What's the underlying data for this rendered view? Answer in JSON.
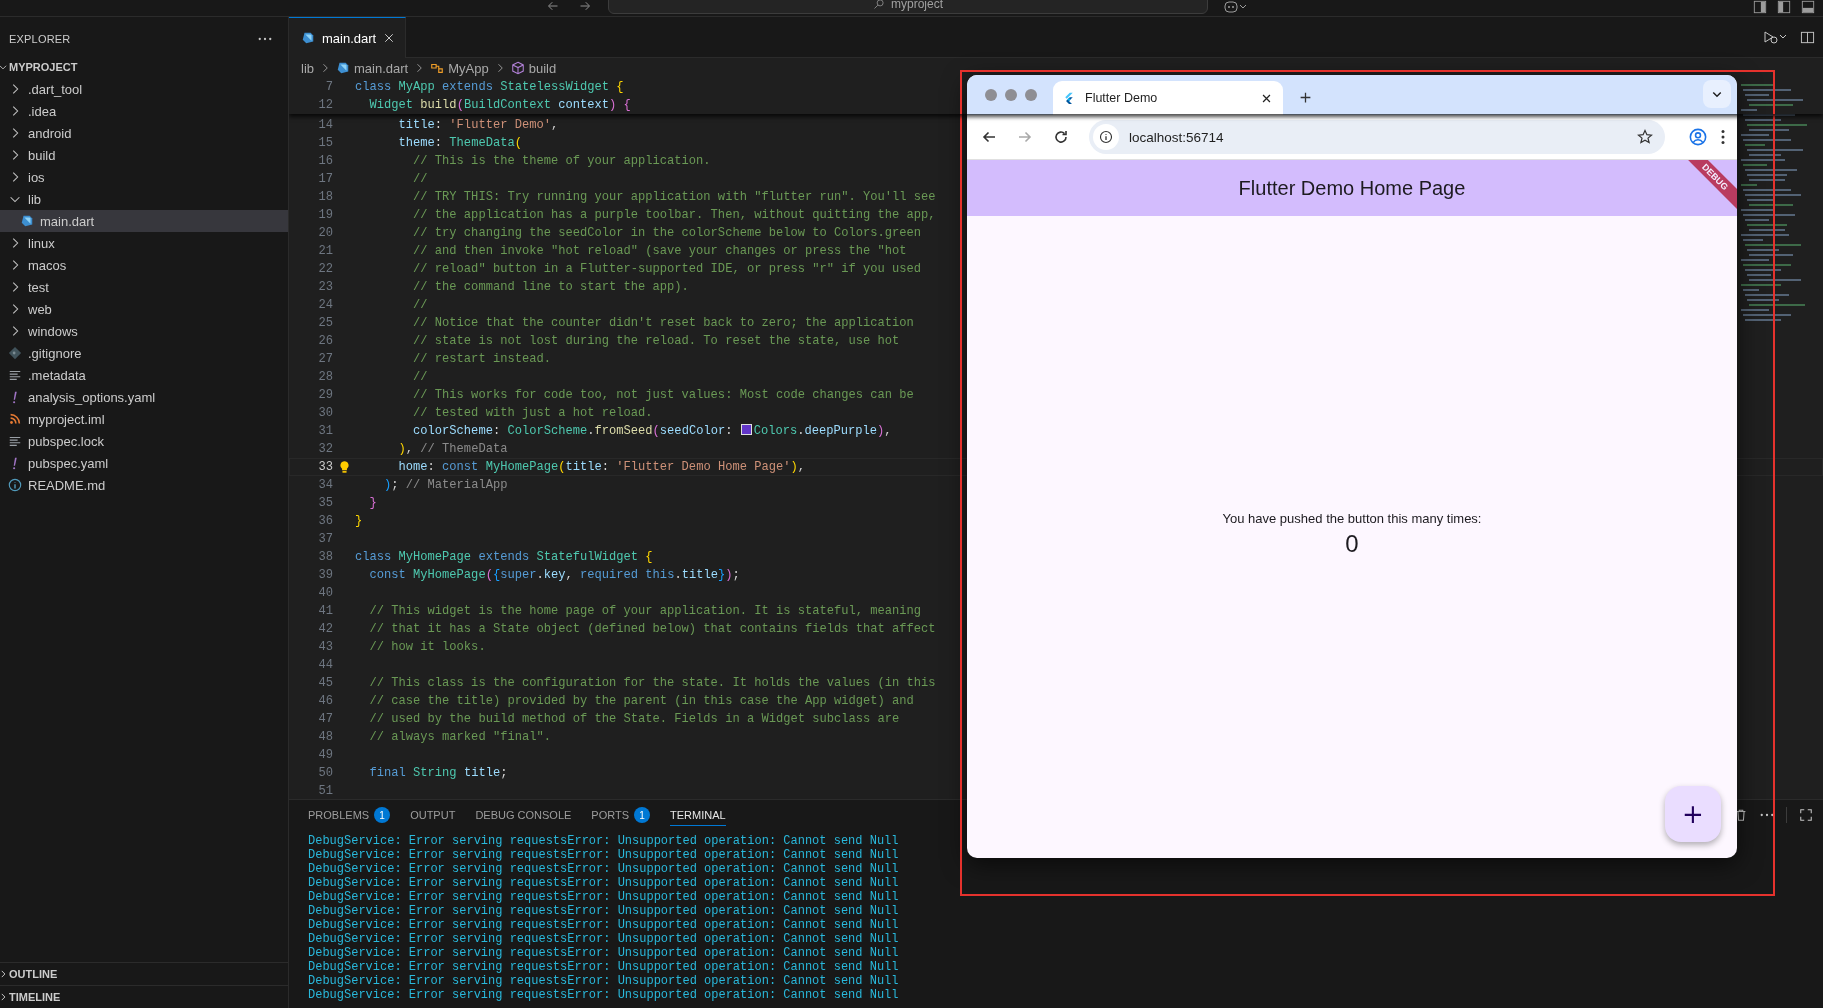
{
  "title_bar": {
    "search": "myproject"
  },
  "explorer": {
    "title": "EXPLORER",
    "project": {
      "label": "MYPROJECT",
      "expanded": true
    },
    "items": [
      {
        "label": ".dart_tool",
        "kind": "folder",
        "expanded": false,
        "selected": false
      },
      {
        "label": ".idea",
        "kind": "folder",
        "expanded": false,
        "selected": false
      },
      {
        "label": "android",
        "kind": "folder",
        "expanded": false,
        "selected": false
      },
      {
        "label": "build",
        "kind": "folder",
        "expanded": false,
        "selected": false
      },
      {
        "label": "ios",
        "kind": "folder",
        "expanded": false,
        "selected": false
      },
      {
        "label": "lib",
        "kind": "folder",
        "expanded": true,
        "selected": false,
        "children": [
          {
            "label": "main.dart",
            "kind": "dart",
            "selected": true
          }
        ]
      },
      {
        "label": "linux",
        "kind": "folder",
        "expanded": false,
        "selected": false
      },
      {
        "label": "macos",
        "kind": "folder",
        "expanded": false,
        "selected": false
      },
      {
        "label": "test",
        "kind": "folder",
        "expanded": false,
        "selected": false
      },
      {
        "label": "web",
        "kind": "folder",
        "expanded": false,
        "selected": false
      },
      {
        "label": "windows",
        "kind": "folder",
        "expanded": false,
        "selected": false
      },
      {
        "label": ".gitignore",
        "kind": "git",
        "selected": false
      },
      {
        "label": ".metadata",
        "kind": "lines",
        "selected": false
      },
      {
        "label": "analysis_options.yaml",
        "kind": "yaml",
        "selected": false
      },
      {
        "label": "myproject.iml",
        "kind": "rss",
        "selected": false
      },
      {
        "label": "pubspec.lock",
        "kind": "lines",
        "selected": false
      },
      {
        "label": "pubspec.yaml",
        "kind": "yaml",
        "selected": false
      },
      {
        "label": "README.md",
        "kind": "info",
        "selected": false
      }
    ],
    "sections": [
      {
        "label": "OUTLINE",
        "expanded": false
      },
      {
        "label": "TIMELINE",
        "expanded": false
      }
    ]
  },
  "editor": {
    "tabs": [
      {
        "label": "main.dart",
        "selected": true
      }
    ],
    "breadcrumbs": [
      {
        "label": "lib",
        "kind": "folder"
      },
      {
        "label": "main.dart",
        "kind": "dart"
      },
      {
        "label": "MyApp",
        "kind": "class"
      },
      {
        "label": "build",
        "kind": "method"
      }
    ],
    "sticky_lines": [
      {
        "number": "7",
        "tokens": [
          {
            "text": "class ",
            "kind": "kw"
          },
          {
            "text": "MyApp ",
            "kind": "type"
          },
          {
            "text": "extends ",
            "kind": "kw"
          },
          {
            "text": "StatelessWidget ",
            "kind": "type"
          },
          {
            "text": "{",
            "kind": "b1"
          }
        ]
      },
      {
        "number": "12",
        "tokens": [
          {
            "text": "  Widget ",
            "kind": "type"
          },
          {
            "text": "build",
            "kind": "fn"
          },
          {
            "text": "(",
            "kind": "b2"
          },
          {
            "text": "BuildContext ",
            "kind": "type"
          },
          {
            "text": "context",
            "kind": "prop"
          },
          {
            "text": ") ",
            "kind": "b2"
          },
          {
            "text": "{",
            "kind": "b2"
          }
        ]
      }
    ],
    "lines": [
      {
        "number": "14",
        "current": false,
        "tokens": [
          {
            "text": "      title",
            "kind": "prop"
          },
          {
            "text": ": "
          },
          {
            "text": "'Flutter Demo'",
            "kind": "str"
          },
          {
            "text": ","
          }
        ]
      },
      {
        "number": "15",
        "current": false,
        "tokens": [
          {
            "text": "      theme",
            "kind": "prop"
          },
          {
            "text": ": "
          },
          {
            "text": "ThemeData",
            "kind": "type"
          },
          {
            "text": "(",
            "kind": "b1"
          }
        ]
      },
      {
        "number": "16",
        "current": false,
        "tokens": [
          {
            "text": "        // This is the theme of your application.",
            "kind": "cm"
          }
        ]
      },
      {
        "number": "17",
        "current": false,
        "tokens": [
          {
            "text": "        //",
            "kind": "cm"
          }
        ]
      },
      {
        "number": "18",
        "current": false,
        "tokens": [
          {
            "text": "        // TRY THIS: Try running your application with \"flutter run\". You'll see",
            "kind": "cm"
          }
        ]
      },
      {
        "number": "19",
        "current": false,
        "tokens": [
          {
            "text": "        // the application has a purple toolbar. Then, without quitting the app,",
            "kind": "cm"
          }
        ]
      },
      {
        "number": "20",
        "current": false,
        "tokens": [
          {
            "text": "        // try changing the seedColor in the colorScheme below to Colors.green",
            "kind": "cm"
          }
        ]
      },
      {
        "number": "21",
        "current": false,
        "tokens": [
          {
            "text": "        // and then invoke \"hot reload\" (save your changes or press the \"hot",
            "kind": "cm"
          }
        ]
      },
      {
        "number": "22",
        "current": false,
        "tokens": [
          {
            "text": "        // reload\" button in a Flutter-supported IDE, or press \"r\" if you used",
            "kind": "cm"
          }
        ]
      },
      {
        "number": "23",
        "current": false,
        "tokens": [
          {
            "text": "        // the command line to start the app).",
            "kind": "cm"
          }
        ]
      },
      {
        "number": "24",
        "current": false,
        "tokens": [
          {
            "text": "        //",
            "kind": "cm"
          }
        ]
      },
      {
        "number": "25",
        "current": false,
        "tokens": [
          {
            "text": "        // Notice that the counter didn't reset back to zero; the application",
            "kind": "cm"
          }
        ]
      },
      {
        "number": "26",
        "current": false,
        "tokens": [
          {
            "text": "        // state is not lost during the reload. To reset the state, use hot",
            "kind": "cm"
          }
        ]
      },
      {
        "number": "27",
        "current": false,
        "tokens": [
          {
            "text": "        // restart instead.",
            "kind": "cm"
          }
        ]
      },
      {
        "number": "28",
        "current": false,
        "tokens": [
          {
            "text": "        //",
            "kind": "cm"
          }
        ]
      },
      {
        "number": "29",
        "current": false,
        "tokens": [
          {
            "text": "        // This works for code too, not just values: Most code changes can be",
            "kind": "cm"
          }
        ]
      },
      {
        "number": "30",
        "current": false,
        "tokens": [
          {
            "text": "        // tested with just a hot reload.",
            "kind": "cm"
          }
        ]
      },
      {
        "number": "31",
        "current": false,
        "tokens": [
          {
            "text": "        colorScheme",
            "kind": "prop"
          },
          {
            "text": ": "
          },
          {
            "text": "ColorScheme",
            "kind": "type"
          },
          {
            "text": "."
          },
          {
            "text": "fromSeed",
            "kind": "fn"
          },
          {
            "text": "(",
            "kind": "b2"
          },
          {
            "text": "seedColor",
            "kind": "prop"
          },
          {
            "text": ": "
          },
          {
            "kind": "swatch",
            "color": "#6236c9"
          },
          {
            "text": "Colors",
            "kind": "type"
          },
          {
            "text": "."
          },
          {
            "text": "deepPurple",
            "kind": "prop"
          },
          {
            "text": ")",
            "kind": "b2"
          },
          {
            "text": ","
          }
        ]
      },
      {
        "number": "32",
        "current": false,
        "tokens": [
          {
            "text": "      )",
            "kind": "b1"
          },
          {
            "text": ", "
          },
          {
            "text": "// ThemeData",
            "kind": "hint"
          }
        ]
      },
      {
        "number": "33",
        "current": true,
        "tokens": [
          {
            "text": "      home",
            "kind": "prop"
          },
          {
            "text": ": "
          },
          {
            "text": "const ",
            "kind": "kw"
          },
          {
            "text": "MyHomePage",
            "kind": "type"
          },
          {
            "text": "(",
            "kind": "b1"
          },
          {
            "text": "title",
            "kind": "prop"
          },
          {
            "text": ": "
          },
          {
            "text": "'Flutter Demo Home Page'",
            "kind": "str"
          },
          {
            "text": ")",
            "kind": "b1"
          },
          {
            "text": ","
          }
        ]
      },
      {
        "number": "34",
        "current": false,
        "tokens": [
          {
            "text": "    )",
            "kind": "b3"
          },
          {
            "text": "; "
          },
          {
            "text": "// MaterialApp",
            "kind": "hint"
          }
        ]
      },
      {
        "number": "35",
        "current": false,
        "tokens": [
          {
            "text": "  }",
            "kind": "b2"
          }
        ]
      },
      {
        "number": "36",
        "current": false,
        "tokens": [
          {
            "text": "}",
            "kind": "b1"
          }
        ]
      },
      {
        "number": "37",
        "current": false
      },
      {
        "number": "38",
        "current": false,
        "tokens": [
          {
            "text": "class ",
            "kind": "kw"
          },
          {
            "text": "MyHomePage ",
            "kind": "type"
          },
          {
            "text": "extends ",
            "kind": "kw"
          },
          {
            "text": "StatefulWidget ",
            "kind": "type"
          },
          {
            "text": "{",
            "kind": "b1"
          }
        ]
      },
      {
        "number": "39",
        "current": false,
        "tokens": [
          {
            "text": "  const ",
            "kind": "kw"
          },
          {
            "text": "MyHomePage",
            "kind": "type"
          },
          {
            "text": "(",
            "kind": "b2"
          },
          {
            "text": "{",
            "kind": "b3"
          },
          {
            "text": "super",
            "kind": "kw"
          },
          {
            "text": "."
          },
          {
            "text": "key",
            "kind": "prop"
          },
          {
            "text": ", "
          },
          {
            "text": "required ",
            "kind": "kw"
          },
          {
            "text": "this",
            "kind": "kw"
          },
          {
            "text": "."
          },
          {
            "text": "title",
            "kind": "prop"
          },
          {
            "text": "}",
            "kind": "b3"
          },
          {
            "text": ")",
            "kind": "b2"
          },
          {
            "text": ";"
          }
        ]
      },
      {
        "number": "40",
        "current": false
      },
      {
        "number": "41",
        "current": false,
        "tokens": [
          {
            "text": "  // This widget is the home page of your application. It is stateful, meaning",
            "kind": "cm"
          }
        ]
      },
      {
        "number": "42",
        "current": false,
        "tokens": [
          {
            "text": "  // that it has a State object (defined below) that contains fields that affect",
            "kind": "cm"
          }
        ]
      },
      {
        "number": "43",
        "current": false,
        "tokens": [
          {
            "text": "  // how it looks.",
            "kind": "cm"
          }
        ]
      },
      {
        "number": "44",
        "current": false
      },
      {
        "number": "45",
        "current": false,
        "tokens": [
          {
            "text": "  // This class is the configuration for the state. It holds the values (in this",
            "kind": "cm"
          }
        ]
      },
      {
        "number": "46",
        "current": false,
        "tokens": [
          {
            "text": "  // case the title) provided by the parent (in this case the App widget) and",
            "kind": "cm"
          }
        ]
      },
      {
        "number": "47",
        "current": false,
        "tokens": [
          {
            "text": "  // used by the build method of the State. Fields in a Widget subclass are",
            "kind": "cm"
          }
        ]
      },
      {
        "number": "48",
        "current": false,
        "tokens": [
          {
            "text": "  // always marked \"final\".",
            "kind": "cm"
          }
        ]
      },
      {
        "number": "49",
        "current": false
      },
      {
        "number": "50",
        "current": false,
        "tokens": [
          {
            "text": "  final ",
            "kind": "kw"
          },
          {
            "text": "String ",
            "kind": "type"
          },
          {
            "text": "title",
            "kind": "prop"
          },
          {
            "text": ";"
          }
        ]
      },
      {
        "number": "51",
        "current": false
      }
    ]
  },
  "panel": {
    "tabs": [
      {
        "label": "PROBLEMS",
        "badge": "1",
        "selected": false
      },
      {
        "label": "OUTPUT",
        "selected": false
      },
      {
        "label": "DEBUG CONSOLE",
        "selected": false
      },
      {
        "label": "PORTS",
        "badge": "1",
        "selected": false
      },
      {
        "label": "TERMINAL",
        "selected": true
      }
    ],
    "terminal_lines": [
      "DebugService: Error serving requestsError: Unsupported operation: Cannot send Null",
      "DebugService: Error serving requestsError: Unsupported operation: Cannot send Null",
      "DebugService: Error serving requestsError: Unsupported operation: Cannot send Null",
      "DebugService: Error serving requestsError: Unsupported operation: Cannot send Null",
      "DebugService: Error serving requestsError: Unsupported operation: Cannot send Null",
      "DebugService: Error serving requestsError: Unsupported operation: Cannot send Null",
      "DebugService: Error serving requestsError: Unsupported operation: Cannot send Null",
      "DebugService: Error serving requestsError: Unsupported operation: Cannot send Null",
      "DebugService: Error serving requestsError: Unsupported operation: Cannot send Null",
      "DebugService: Error serving requestsError: Unsupported operation: Cannot send Null",
      "DebugService: Error serving requestsError: Unsupported operation: Cannot send Null",
      "DebugService: Error serving requestsError: Unsupported operation: Cannot send Null"
    ]
  },
  "browser": {
    "tab": {
      "title": "Flutter Demo"
    },
    "nav_buttons": [
      {
        "kind": "back",
        "disabled": false
      },
      {
        "kind": "forward",
        "disabled": true
      },
      {
        "kind": "reload",
        "disabled": false
      }
    ],
    "url": "localhost:56714",
    "app": {
      "app_bar_title": "Flutter Demo Home Page",
      "debug_banner": "DEBUG",
      "message": "You have pushed the button this many times:",
      "counter": "0",
      "fab": "+"
    }
  }
}
